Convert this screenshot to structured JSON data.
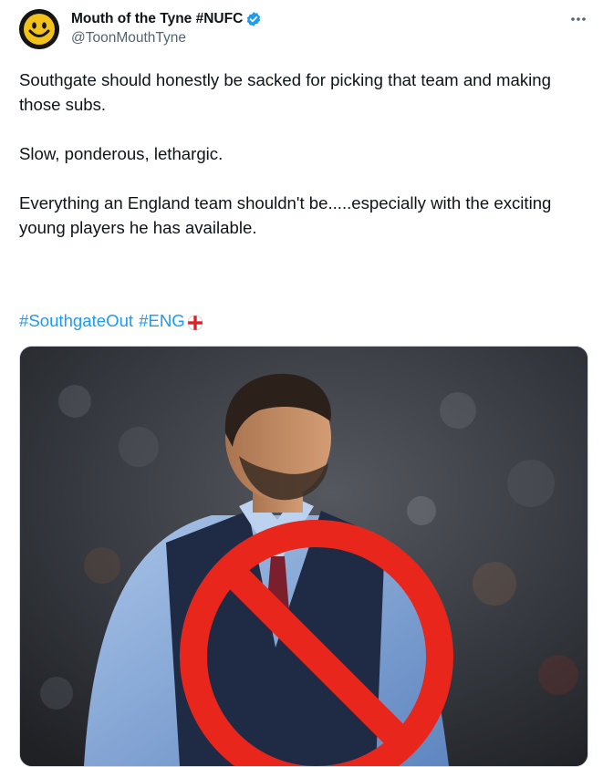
{
  "author": {
    "display_name": "Mouth of the Tyne #NUFC",
    "handle": "@ToonMouthTyne",
    "verified": true,
    "avatar_icon": "smiley-face-icon"
  },
  "tweet": {
    "paragraphs": [
      "Southgate should honestly be sacked for picking that team and making those subs.",
      "Slow, ponderous, lethargic.",
      "Everything an England team shouldn't be.....especially with the exciting young players he has available."
    ],
    "hashtags": [
      "#SouthgateOut",
      "#ENG"
    ],
    "emoji": "england-flag-icon"
  },
  "media": {
    "icon": "prohibited-sign-icon"
  },
  "colors": {
    "link": "#1d9bf0",
    "verified": "#1d9bf0",
    "secondary_text": "#536471",
    "prohibited": "#e8261c"
  }
}
